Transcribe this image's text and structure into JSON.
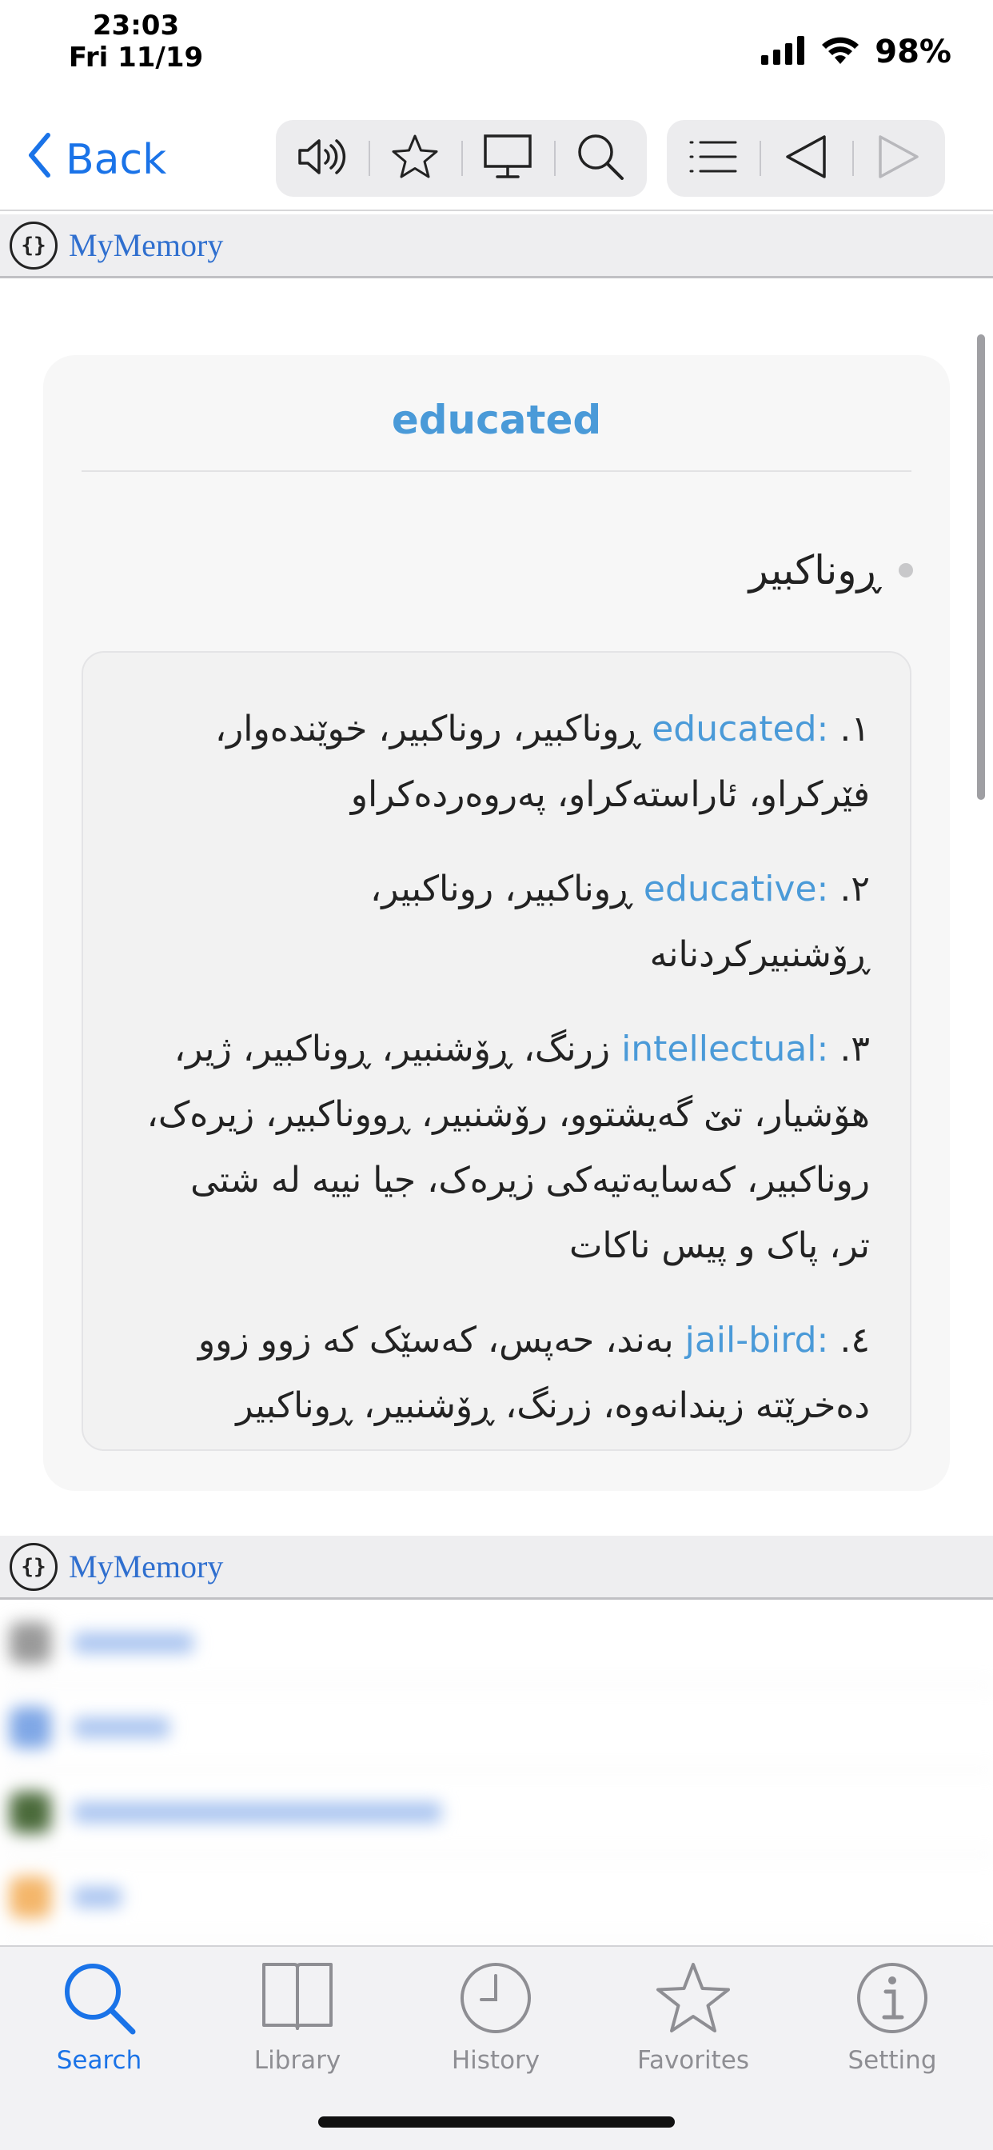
{
  "status_bar": {
    "time": "23:03",
    "date": "Fri 11/19",
    "battery": "98%"
  },
  "nav": {
    "back_label": "Back",
    "toolbar_icons": [
      "speaker-icon",
      "star-icon",
      "monitor-icon",
      "search-icon",
      "list-icon",
      "prev-icon",
      "next-icon"
    ]
  },
  "source_bar": {
    "label": "MyMemory",
    "icon_text": "{}"
  },
  "entry": {
    "title": "educated",
    "main_term": "ڕوناکبیر",
    "definitions": [
      {
        "num": "١.",
        "word": "educated:",
        "text": "ڕوناکبیر، روناکبیر، خوێندەوار، فێرکراو، ئاراستەکراو، پەروەردەکراو"
      },
      {
        "num": "٢.",
        "word": "educative:",
        "text": "ڕوناکبیر، روناکبیر، ڕۆشنبیرکردنانە"
      },
      {
        "num": "٣.",
        "word": "intellectual:",
        "text": "زرنگ، ڕۆشنبیر، ڕوناکبیر، ژیر، هۆشیار، تێ گەیشتوو، رۆشنبیر، ڕووناکبیر، زیرەک، روناکبیر، کەسایەتیەکی زیرەک، جیا نییە لە شتی تر، پاک و پیس ناکات"
      },
      {
        "num": "٤.",
        "word": "jail-bird:",
        "text": "بەند، حەپس، کەسێک کە زوو زوو دەخرێتە زیندانەوە، زرنگ، ڕۆشنبیر، ڕوناکبیر"
      }
    ]
  },
  "source_bar_2": {
    "label": "MyMemory",
    "icon_text": "{}"
  },
  "tabs": [
    {
      "label": "Search",
      "icon": "search-icon",
      "active": true
    },
    {
      "label": "Library",
      "icon": "book-icon",
      "active": false
    },
    {
      "label": "History",
      "icon": "clock-icon",
      "active": false
    },
    {
      "label": "Favorites",
      "icon": "star-icon",
      "active": false
    },
    {
      "label": "Setting",
      "icon": "info-icon",
      "active": false
    }
  ],
  "colors": {
    "accent": "#1a73e8",
    "term_blue": "#4a9ad8",
    "source_blue": "#2f6fcf"
  }
}
